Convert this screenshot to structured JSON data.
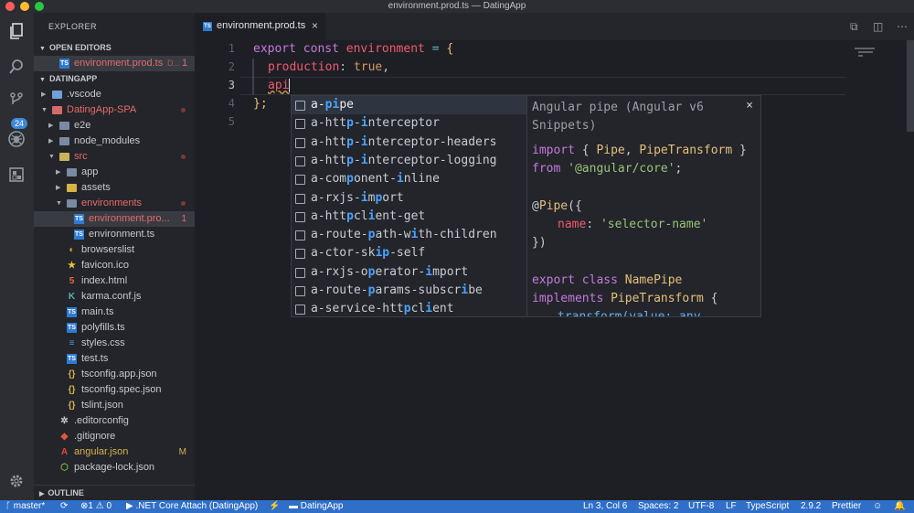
{
  "window": {
    "title": "environment.prod.ts — DatingApp"
  },
  "colors": {
    "accent": "#2f6fc8",
    "error": "#e66a6a",
    "badge": "#3d88d6"
  },
  "activity": {
    "items": [
      "files-icon",
      "search-icon",
      "source-control-icon",
      "debug-icon",
      "extensions-icon",
      "settings-icon"
    ],
    "scm_badge": "24"
  },
  "explorer": {
    "title": "EXPLORER",
    "open_editors_label": "OPEN EDITORS",
    "open_editor": {
      "name": "environment.prod.ts",
      "folder": "D...",
      "count": "1"
    },
    "project_label": "DATINGAPP",
    "tree": [
      {
        "label": ".vscode"
      },
      {
        "label": "DatingApp-SPA"
      },
      {
        "label": "e2e"
      },
      {
        "label": "node_modules"
      },
      {
        "label": "src"
      },
      {
        "label": "app"
      },
      {
        "label": "assets"
      },
      {
        "label": "environments"
      },
      {
        "label": "environment.pro...",
        "count": "1"
      },
      {
        "label": "environment.ts"
      },
      {
        "label": "browserslist"
      },
      {
        "label": "favicon.ico"
      },
      {
        "label": "index.html"
      },
      {
        "label": "karma.conf.js"
      },
      {
        "label": "main.ts"
      },
      {
        "label": "polyfills.ts"
      },
      {
        "label": "styles.css"
      },
      {
        "label": "test.ts"
      },
      {
        "label": "tsconfig.app.json"
      },
      {
        "label": "tsconfig.spec.json"
      },
      {
        "label": "tslint.json"
      },
      {
        "label": ".editorconfig"
      },
      {
        "label": ".gitignore"
      },
      {
        "label": "angular.json",
        "mark": "M"
      },
      {
        "label": "package-lock.json"
      }
    ],
    "outline_label": "OUTLINE"
  },
  "editor": {
    "tab": {
      "label": "environment.prod.ts",
      "close": "×"
    },
    "line_numbers": [
      "1",
      "2",
      "3",
      "4",
      "5"
    ],
    "code": {
      "l1": {
        "kw1": "export",
        "kw2": "const",
        "name": "environment",
        "eq": "=",
        "brace": "{"
      },
      "l2": {
        "key": "production",
        "colon": ":",
        "val": "true",
        "comma": ","
      },
      "l3": {
        "typed": "api"
      },
      "l4": {
        "text": "};"
      }
    }
  },
  "suggest": {
    "items": [
      {
        "parts": [
          [
            "a-",
            false
          ],
          [
            "pi",
            true
          ],
          [
            "pe",
            false
          ]
        ]
      },
      {
        "parts": [
          [
            "a-htt",
            false
          ],
          [
            "p",
            true
          ],
          [
            "-",
            false
          ],
          [
            "i",
            true
          ],
          [
            "nterceptor",
            false
          ]
        ]
      },
      {
        "parts": [
          [
            "a-htt",
            false
          ],
          [
            "p",
            true
          ],
          [
            "-",
            false
          ],
          [
            "i",
            true
          ],
          [
            "nterceptor-headers",
            false
          ]
        ]
      },
      {
        "parts": [
          [
            "a-htt",
            false
          ],
          [
            "p",
            true
          ],
          [
            "-",
            false
          ],
          [
            "i",
            true
          ],
          [
            "nterceptor-logging",
            false
          ]
        ]
      },
      {
        "parts": [
          [
            "a-com",
            false
          ],
          [
            "p",
            true
          ],
          [
            "onent-",
            false
          ],
          [
            "i",
            true
          ],
          [
            "nline",
            false
          ]
        ]
      },
      {
        "parts": [
          [
            "a-rxjs-",
            false
          ],
          [
            "i",
            true
          ],
          [
            "m",
            false
          ],
          [
            "p",
            true
          ],
          [
            "ort",
            false
          ]
        ]
      },
      {
        "parts": [
          [
            "a-htt",
            false
          ],
          [
            "p",
            true
          ],
          [
            "cl",
            false
          ],
          [
            "i",
            true
          ],
          [
            "ent-get",
            false
          ]
        ]
      },
      {
        "parts": [
          [
            "a-route-",
            false
          ],
          [
            "p",
            true
          ],
          [
            "ath-w",
            false
          ],
          [
            "i",
            true
          ],
          [
            "th-children",
            false
          ]
        ]
      },
      {
        "parts": [
          [
            "a-ctor-sk",
            false
          ],
          [
            "ip",
            true
          ],
          [
            "-self",
            false
          ]
        ]
      },
      {
        "parts": [
          [
            "a-rxjs-o",
            false
          ],
          [
            "p",
            true
          ],
          [
            "erator-",
            false
          ],
          [
            "i",
            true
          ],
          [
            "mport",
            false
          ]
        ]
      },
      {
        "parts": [
          [
            "a-route-",
            false
          ],
          [
            "p",
            true
          ],
          [
            "arams-subscr",
            false
          ],
          [
            "i",
            true
          ],
          [
            "be",
            false
          ]
        ]
      },
      {
        "parts": [
          [
            "a-service-htt",
            false
          ],
          [
            "p",
            true
          ],
          [
            "cl",
            false
          ],
          [
            "i",
            true
          ],
          [
            "ent",
            false
          ]
        ]
      }
    ],
    "detail": "Angular pipe (Angular v6 Snippets)",
    "close": "×",
    "doc": {
      "l1": [
        "import",
        "{ ",
        "Pipe",
        ", ",
        "PipeTransform",
        " }"
      ],
      "l2": [
        "from",
        "'@angular/core'",
        ";"
      ],
      "l3": [
        "@",
        "Pipe",
        "({"
      ],
      "l4": [
        "name",
        ": ",
        "'selector-name'"
      ],
      "l5": "})",
      "l6": [
        "export",
        "class",
        "NamePipe"
      ],
      "l7": [
        "implements",
        "PipeTransform",
        " {"
      ],
      "l8": "transform(value: any"
    }
  },
  "status": {
    "branch": "master*",
    "errors": "1",
    "warnings": "0",
    "debug": ".NET Core Attach (DatingApp)",
    "folder": "DatingApp",
    "position": "Ln 3, Col 6",
    "spaces": "Spaces: 2",
    "encoding": "UTF-8",
    "eol": "LF",
    "language": "TypeScript",
    "version": "2.9.2",
    "formatter": "Prettier"
  }
}
